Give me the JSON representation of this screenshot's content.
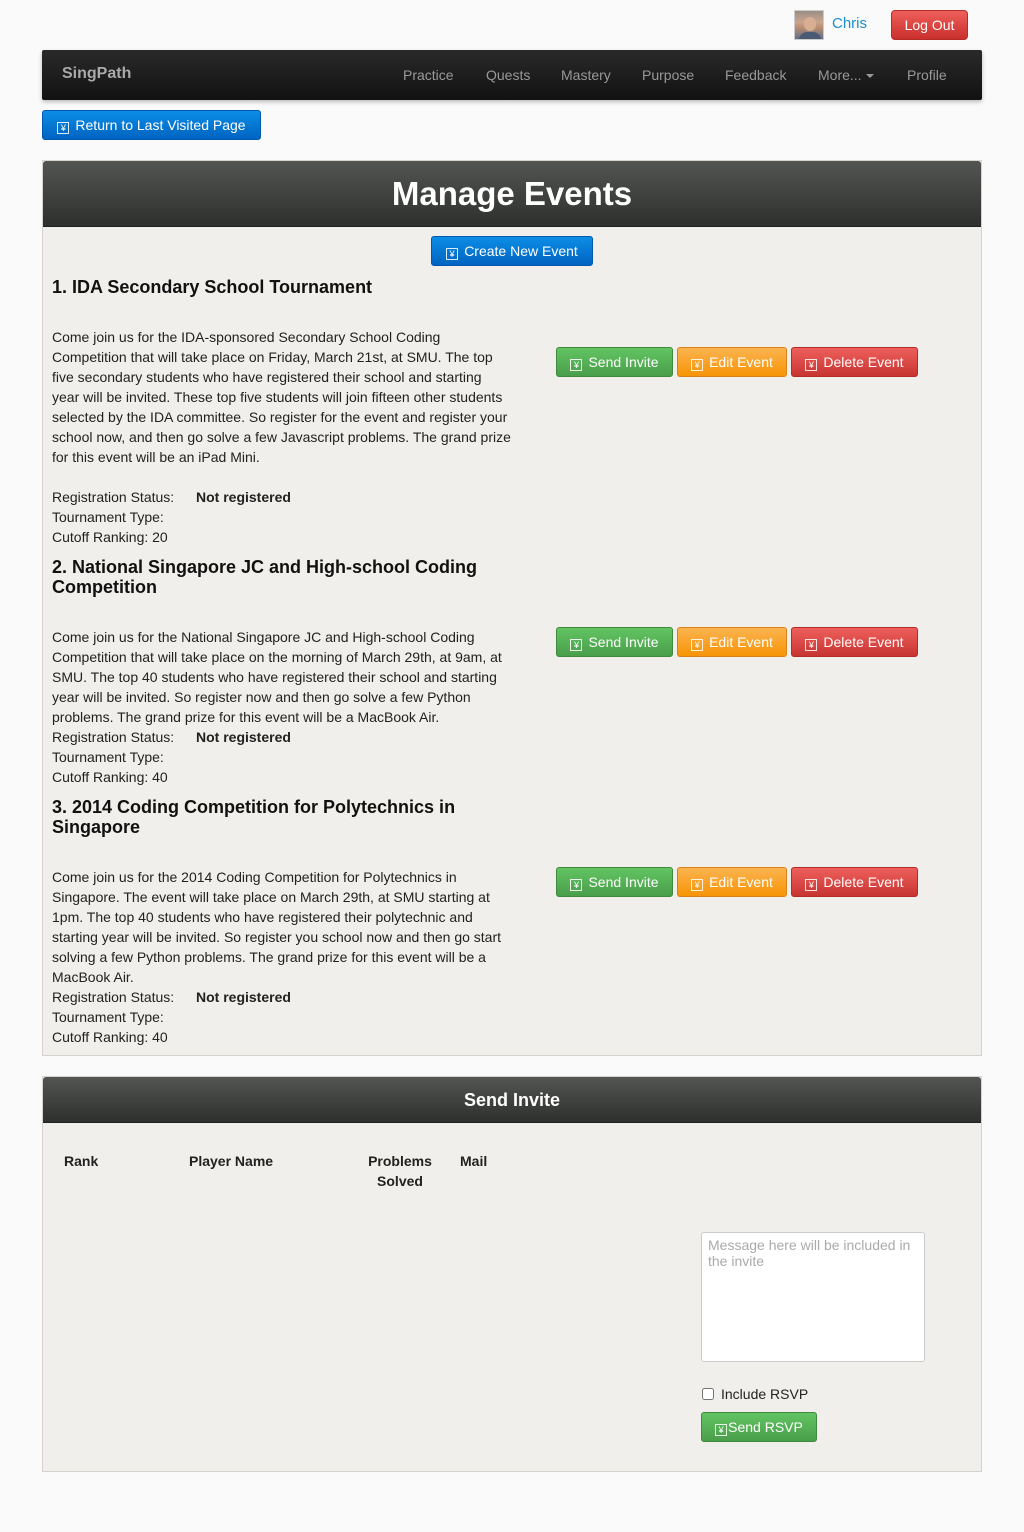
{
  "user": {
    "name": "Chris",
    "logout_label": "Log Out"
  },
  "navbar": {
    "brand": "SingPath",
    "items": [
      "Practice",
      "Quests",
      "Mastery",
      "Purpose",
      "Feedback",
      "More...",
      "Profile"
    ]
  },
  "return_button": "Return to Last Visited Page",
  "manage_events": {
    "title": "Manage Events",
    "create_label": "Create New Event",
    "actions": {
      "send_invite": "Send Invite",
      "edit": "Edit Event",
      "delete": "Delete Event"
    },
    "labels": {
      "registration_status": "Registration Status:",
      "tournament_type": "Tournament Type:",
      "cutoff_ranking": "Cutoff Ranking:"
    },
    "events": [
      {
        "title": "1. IDA Secondary School Tournament",
        "description": "Come join us for the IDA-sponsored Secondary School Coding Competition that will take place on Friday, March 21st, at SMU. The top five secondary students who have registered their school and starting year will be invited. These top five students will join fifteen other students selected by the IDA committee. So register for the event and register your school now, and then go solve a few Javascript problems. The grand prize for this event will be an iPad Mini.",
        "registration_status": "Not registered",
        "tournament_type": "",
        "cutoff_ranking": "20"
      },
      {
        "title": "2. National Singapore JC and High-school Coding Competition",
        "description": "Come join us for the National Singapore JC and High-school Coding Competition that will take place on the morning of March 29th, at 9am, at SMU. The top 40 students who have registered their school and starting year will be invited. So register now and then go solve a few Python problems. The grand prize for this event will be a MacBook Air.",
        "registration_status": "Not registered",
        "tournament_type": "",
        "cutoff_ranking": "40"
      },
      {
        "title": "3. 2014 Coding Competition for Polytechnics in Singapore",
        "description": "Come join us for the 2014 Coding Competition for Polytechnics in Singapore. The event will take place on March 29th, at SMU starting at 1pm. The top 40 students who have registered their polytechnic and starting year will be invited. So register you school now and then go start solving a few Python problems. The grand prize for this event will be a MacBook Air.",
        "registration_status": "Not registered",
        "tournament_type": "",
        "cutoff_ranking": "40"
      }
    ]
  },
  "send_invite": {
    "title": "Send Invite",
    "columns": [
      "Rank",
      "Player Name",
      "Problems Solved",
      "Mail"
    ],
    "message_placeholder": "Message here will be included in the invite",
    "include_rsvp_label": "Include RSVP",
    "send_rsvp_label": "Send RSVP"
  },
  "colors": {
    "primary": "#0070d0",
    "success": "#5bb75b",
    "warning": "#faa732",
    "danger": "#da4f49",
    "link": "#1a8ed1"
  }
}
